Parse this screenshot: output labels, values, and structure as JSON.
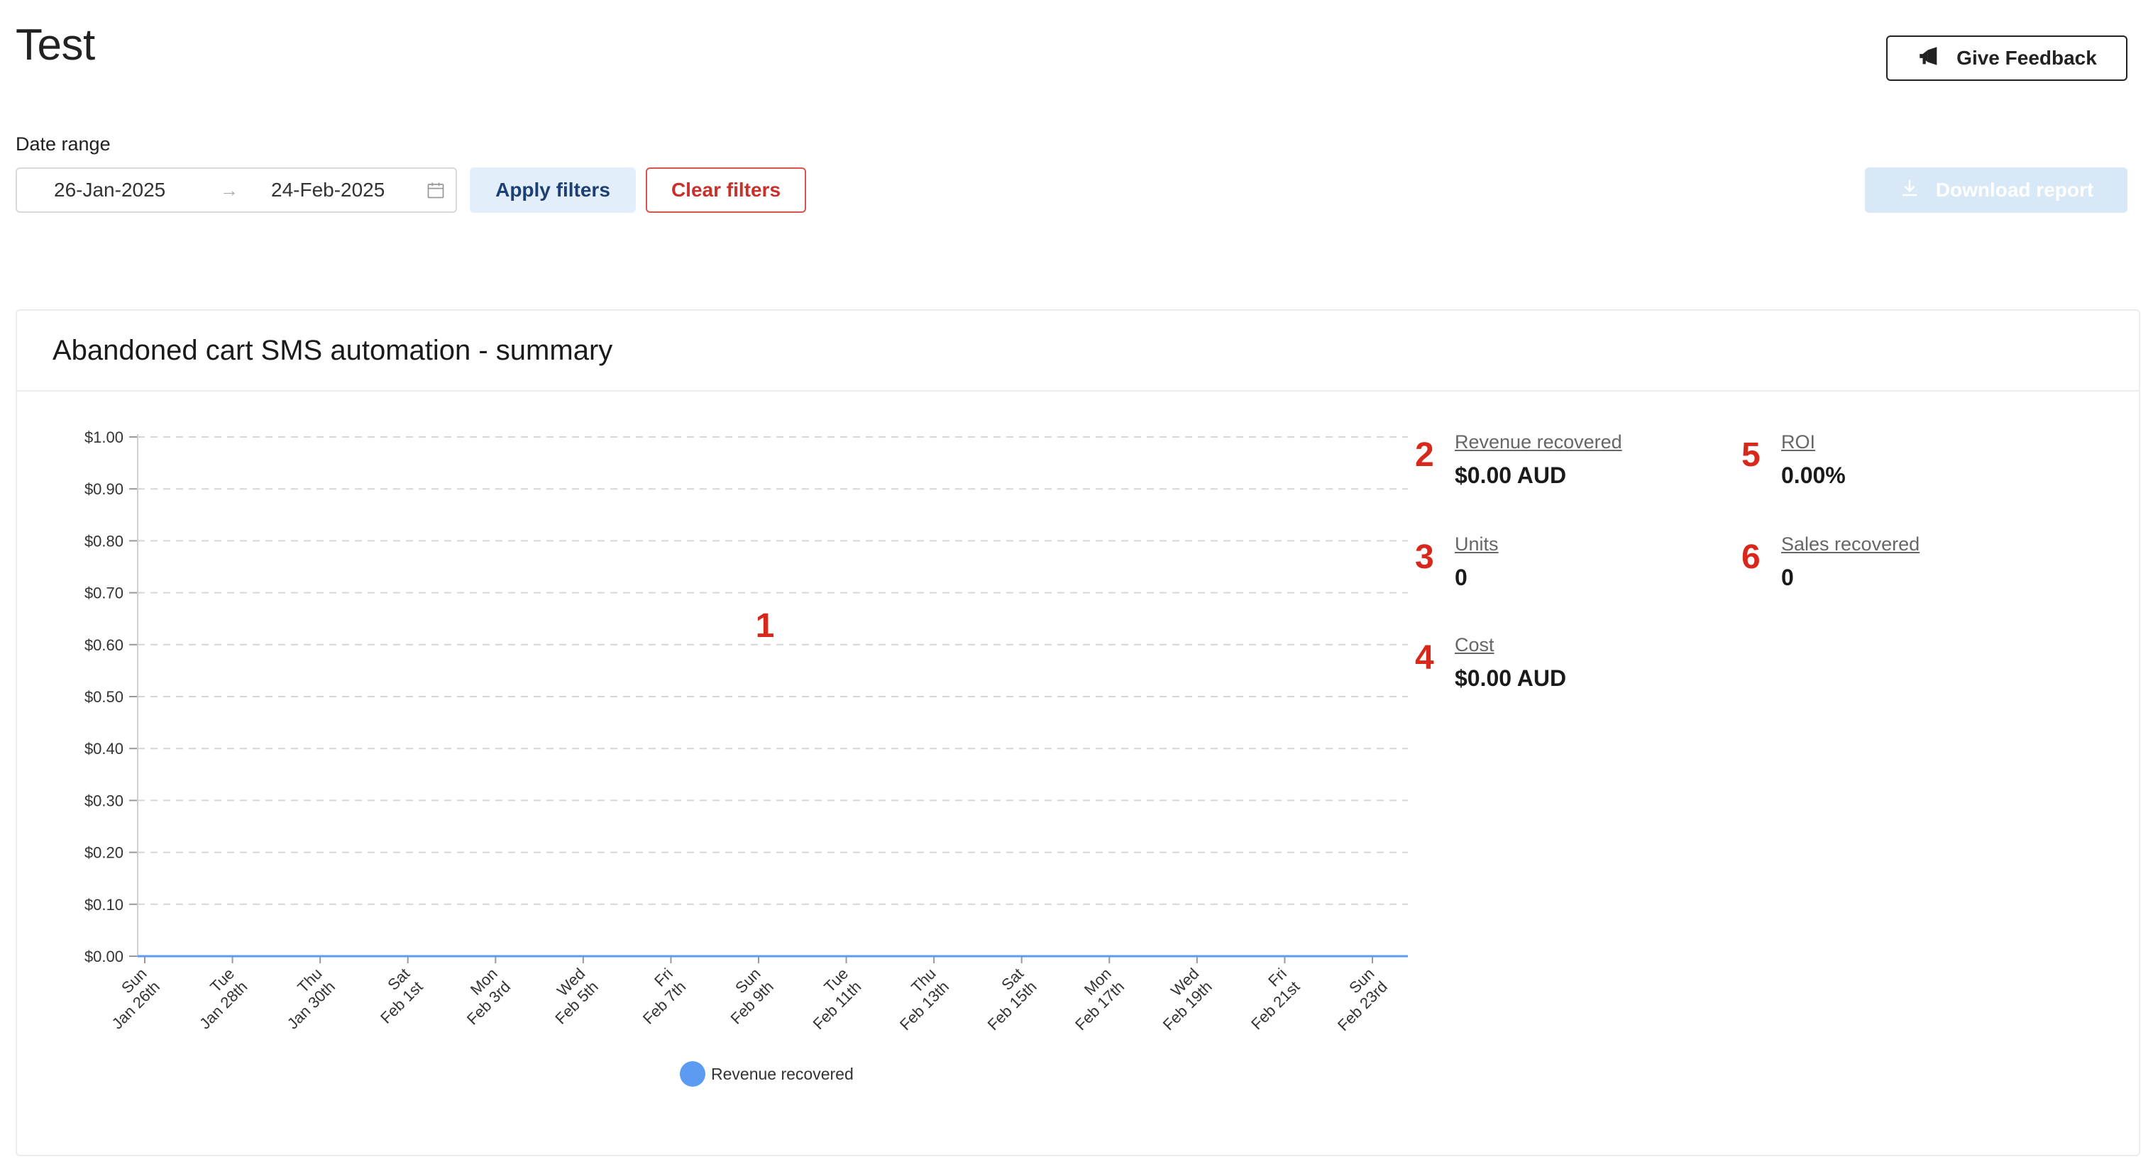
{
  "page": {
    "title": "Test"
  },
  "header": {
    "feedback_label": "Give Feedback",
    "feedback_icon": "megaphone-icon"
  },
  "filters": {
    "date_label": "Date range",
    "start_date": "26-Jan-2025",
    "arrow": "→",
    "end_date": "24-Feb-2025",
    "apply_label": "Apply filters",
    "clear_label": "Clear filters",
    "download_label": "Download report"
  },
  "card": {
    "title": "Abandoned cart SMS automation - summary"
  },
  "chart_data": {
    "type": "line",
    "title": "",
    "xlabel": "",
    "ylabel": "",
    "ylim": [
      0,
      1
    ],
    "y_ticks": [
      "$0.00",
      "$0.10",
      "$0.20",
      "$0.30",
      "$0.40",
      "$0.50",
      "$0.60",
      "$0.70",
      "$0.80",
      "$0.90",
      "$1.00"
    ],
    "categories": [
      [
        "Sun",
        "Jan 26th"
      ],
      [
        "Tue",
        "Jan 28th"
      ],
      [
        "Thu",
        "Jan 30th"
      ],
      [
        "Sat",
        "Feb 1st"
      ],
      [
        "Mon",
        "Feb 3rd"
      ],
      [
        "Wed",
        "Feb 5th"
      ],
      [
        "Fri",
        "Feb 7th"
      ],
      [
        "Sun",
        "Feb 9th"
      ],
      [
        "Tue",
        "Feb 11th"
      ],
      [
        "Thu",
        "Feb 13th"
      ],
      [
        "Sat",
        "Feb 15th"
      ],
      [
        "Mon",
        "Feb 17th"
      ],
      [
        "Wed",
        "Feb 19th"
      ],
      [
        "Fri",
        "Feb 21st"
      ],
      [
        "Sun",
        "Feb 23rd"
      ]
    ],
    "series": [
      {
        "name": "Revenue recovered",
        "color": "#5b9cf2",
        "values": [
          0,
          0,
          0,
          0,
          0,
          0,
          0,
          0,
          0,
          0,
          0,
          0,
          0,
          0,
          0
        ]
      }
    ],
    "grid": true,
    "legend": "bottom-center",
    "annotation": "1"
  },
  "stats": {
    "revenue": {
      "num": "2",
      "label": "Revenue recovered",
      "value": "$0.00 AUD"
    },
    "units": {
      "num": "3",
      "label": "Units",
      "value": "0"
    },
    "cost": {
      "num": "4",
      "label": "Cost",
      "value": "$0.00 AUD"
    },
    "roi": {
      "num": "5",
      "label": "ROI",
      "value": "0.00%"
    },
    "sales": {
      "num": "6",
      "label": "Sales recovered",
      "value": "0"
    }
  },
  "colors": {
    "accent": "#5b9cf2",
    "danger": "#d9534f",
    "annotation": "#d8281b"
  }
}
